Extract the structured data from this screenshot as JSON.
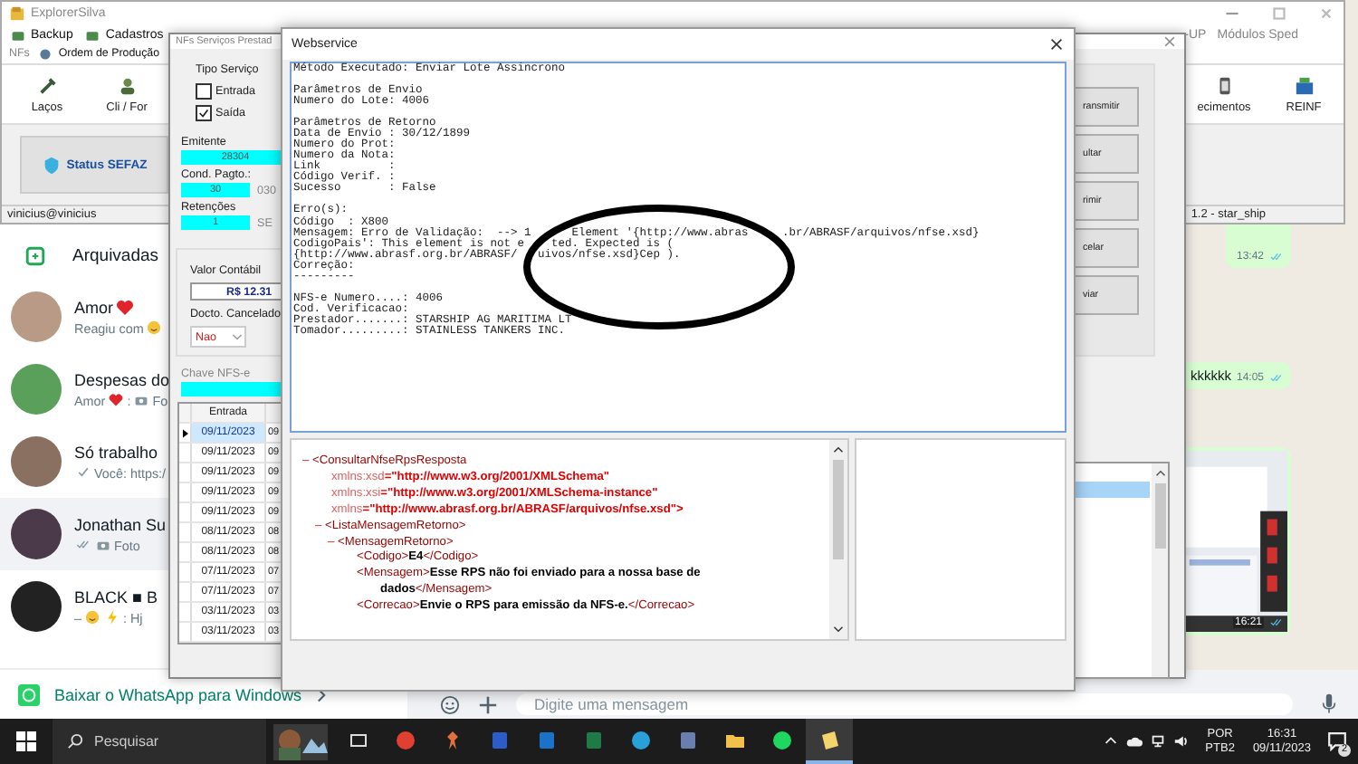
{
  "whatsapp": {
    "archived": {
      "label": "Arquivadas"
    },
    "chats": [
      {
        "title": [
          {
            "kind": "text",
            "text": "Amor"
          },
          {
            "kind": "heart"
          }
        ],
        "preview": [
          {
            "kind": "text",
            "text": "Reagiu com"
          },
          {
            "kind": "face"
          }
        ],
        "selected": false
      },
      {
        "title": [
          {
            "kind": "text",
            "text": "Despesas do"
          }
        ],
        "preview": [
          {
            "kind": "text",
            "text": "Amor"
          },
          {
            "kind": "heart"
          },
          {
            "kind": "text",
            "text": ":"
          },
          {
            "kind": "camera"
          },
          {
            "kind": "text",
            "text": "Fo"
          }
        ],
        "selected": false
      },
      {
        "title": [
          {
            "kind": "text",
            "text": "Só trabalho"
          }
        ],
        "preview": [
          {
            "kind": "tick"
          },
          {
            "kind": "text",
            "text": "Você: https:/"
          }
        ],
        "selected": false
      },
      {
        "title": [
          {
            "kind": "text",
            "text": "Jonathan Su"
          }
        ],
        "preview": [
          {
            "kind": "ticks"
          },
          {
            "kind": "camera"
          },
          {
            "kind": "text",
            "text": "Foto"
          }
        ],
        "selected": true
      },
      {
        "title": [
          {
            "kind": "text",
            "text": "BLACK ■ B"
          }
        ],
        "preview": [
          {
            "kind": "text",
            "text": "–"
          },
          {
            "kind": "face"
          },
          {
            "kind": "bolt"
          },
          {
            "kind": "text",
            "text": ": Hj"
          }
        ],
        "selected": false
      }
    ],
    "messages": [
      {
        "kind": "text",
        "time": "13:42",
        "read": true
      },
      {
        "kind": "text",
        "text": "kkkkkk",
        "time": "14:05",
        "read": true
      },
      {
        "time": "16:21",
        "read": true
      }
    ],
    "download_banner": "Baixar o WhatsApp para Windows",
    "composer": {
      "placeholder": "Digite uma mensagem"
    }
  },
  "explorer": {
    "title": "ExplorerSilva",
    "menu": [
      {
        "label": "Backup",
        "disabled": false
      },
      {
        "label": "Cadastros",
        "disabled": false
      }
    ],
    "menu_right": [
      {
        "label": "-UP",
        "disabled": true
      },
      {
        "label": "Módulos Sped",
        "disabled": true
      }
    ],
    "menu_2": [
      {
        "label": "NFs",
        "disabled": true
      },
      {
        "label": "Ordem de Produção",
        "disabled": false
      }
    ],
    "tools": [
      {
        "label": "Laços",
        "kind": "tools"
      },
      {
        "label": "Cli / For",
        "kind": "people"
      }
    ],
    "tools_right": [
      {
        "label": "ecimentos",
        "kind": "clipboard"
      },
      {
        "label": "REINF",
        "kind": "reinf"
      }
    ],
    "status_button": "Status SEFAZ",
    "user": "vinicius@vinicius",
    "version": "1.2 - star_ship"
  },
  "nfs": {
    "title": "NFs Serviços Prestad",
    "tipo_label": "Tipo Serviço",
    "options": [
      {
        "label": "Entrada",
        "checked": false
      },
      {
        "label": "Saída",
        "checked": true
      }
    ],
    "emitente": {
      "label": "Emitente",
      "value": "28304"
    },
    "cond_pagto": {
      "label": "Cond. Pagto.:",
      "value": "30",
      "extra": "030"
    },
    "retencoes": {
      "label": "Retenções",
      "value": "1",
      "extra": "SE"
    },
    "valor": {
      "label": "Valor Contábil",
      "value": "R$ 12.31"
    },
    "cancelado": {
      "label": "Docto. Cancelado",
      "value": "Nao"
    },
    "chave": {
      "label": "Chave NFS-e"
    },
    "grid": {
      "columns": [
        "Entrada"
      ],
      "rows": [
        {
          "entrada": "09/11/2023",
          "column_2": "09",
          "selected": true
        },
        {
          "entrada": "09/11/2023",
          "column_2": "09",
          "selected": false
        },
        {
          "entrada": "09/11/2023",
          "column_2": "09",
          "selected": false
        },
        {
          "entrada": "09/11/2023",
          "column_2": "09",
          "selected": false
        },
        {
          "entrada": "09/11/2023",
          "column_2": "09",
          "selected": false
        },
        {
          "entrada": "08/11/2023",
          "column_2": "08",
          "selected": false
        },
        {
          "entrada": "08/11/2023",
          "column_2": "08",
          "selected": false
        },
        {
          "entrada": "07/11/2023",
          "column_2": "07",
          "selected": false
        },
        {
          "entrada": "07/11/2023",
          "column_2": "07",
          "selected": false
        },
        {
          "entrada": "03/11/2023",
          "column_2": "03",
          "selected": false
        },
        {
          "entrada": "03/11/2023",
          "column_2": "03",
          "selected": false
        }
      ]
    },
    "actions": [
      "ransmitir",
      "ultar",
      "rimir",
      "celar",
      "viar"
    ]
  },
  "webservice": {
    "title": "Webservice",
    "blocks": [
      [
        "Método Executado: Enviar Lote Assincrono"
      ],
      [
        "Parâmetros de Envio",
        "Numero do Lote: 4006"
      ],
      [
        "Parâmetros de Retorno",
        "Data de Envio : 30/12/1899",
        "Numero do Prot:",
        "Numero da Nota:",
        "Link          :",
        "Código Verif. :",
        "Sucesso       : False"
      ],
      [
        "Erro(s):",
        "Código  : X800",
        "Mensagem: Erro de Validação:  --> 1      Element '{http://www.abras     .br/ABRASF/arquivos/nfse.xsd}",
        "CodigoPais': This element is not e    ted. Expected is (",
        "{http://www.abrasf.org.br/ABRASF/   uivos/nfse.xsd}Cep ).",
        "Correção:",
        "---------"
      ],
      [
        "NFS-e Numero....: 4006",
        "Cod. Verificacao:",
        "Prestador.......: STARSHIP AG MARITIMA LT",
        "Tomador.........: STAINLESS TANKERS INC."
      ]
    ],
    "xml": {
      "toggle": "–",
      "open": "<ConsultarNfseRpsResposta",
      "attributes": [
        {
          "name": "xmlns:xsd",
          "value": "=\"http://www.w3.org/2001/XMLSchema\""
        },
        {
          "name": "xmlns:xsi",
          "value": "=\"http://www.w3.org/2001/XMLSchema-instance\""
        },
        {
          "name": "xmlns",
          "value": "=\"http://www.abrasf.org.br/ABRASF/arquivos/nfse.xsd\">"
        }
      ],
      "children": [
        {
          "toggle": "–",
          "open": "<ListaMensagemRetorno>",
          "children": [
            {
              "toggle": "–",
              "open": "<MensagemRetorno>",
              "children": [
                {
                  "open": "<Codigo>",
                  "text": "E4",
                  "close": "</Codigo>"
                },
                {
                  "open": "<Mensagem>",
                  "text": "Esse RPS não foi enviado para a nossa base de dados",
                  "close": "</Mensagem>"
                },
                {
                  "open": "<Correcao>",
                  "text": "Envie o RPS para emissão da NFS-e.",
                  "close": "</Correcao>"
                }
              ]
            }
          ]
        }
      ]
    }
  },
  "taskbar": {
    "search": {
      "placeholder": "Pesquisar"
    },
    "apps": [
      {
        "kind": "taskview",
        "selected": false
      },
      {
        "kind": "globe",
        "selected": false
      },
      {
        "kind": "pin",
        "selected": false
      },
      {
        "kind": "document",
        "selected": false
      },
      {
        "kind": "mail",
        "selected": false
      },
      {
        "kind": "sheet",
        "selected": false
      },
      {
        "kind": "wave",
        "selected": false
      },
      {
        "kind": "calculator",
        "selected": false
      },
      {
        "kind": "folder",
        "selected": false
      },
      {
        "kind": "music",
        "selected": false
      },
      {
        "kind": "note",
        "selected": true
      }
    ],
    "tray": {
      "language": "POR",
      "layout": "PTB2",
      "time": "16:31",
      "date": "09/11/2023",
      "notifications": "2"
    }
  }
}
